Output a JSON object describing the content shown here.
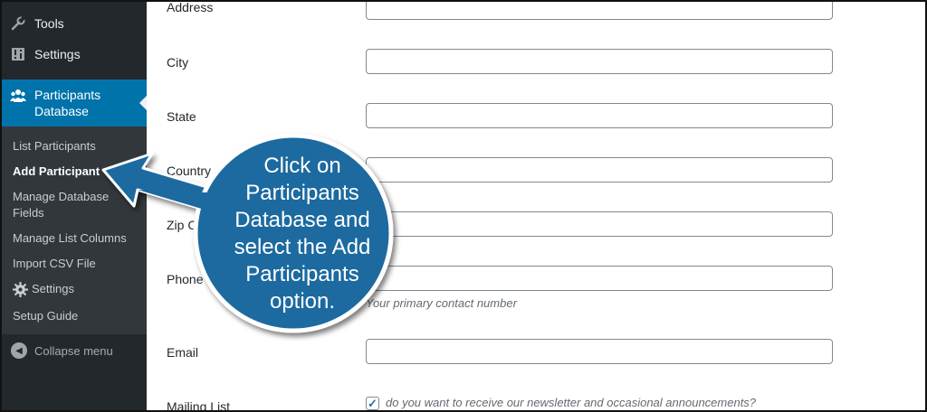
{
  "sidebar": {
    "items": [
      {
        "label": "Tools",
        "icon": "wrench-icon"
      },
      {
        "label": "Settings",
        "icon": "settings-sliders-icon"
      },
      {
        "label": "Participants Database",
        "icon": "participants-group-icon",
        "active": true
      }
    ],
    "submenu": [
      {
        "label": "List Participants"
      },
      {
        "label": "Add Participant",
        "current": true
      },
      {
        "label": "Manage Database Fields"
      },
      {
        "label": "Manage List Columns"
      },
      {
        "label": "Import CSV File"
      },
      {
        "label": "Settings",
        "icon": "gear-icon"
      },
      {
        "label": "Setup Guide"
      }
    ],
    "collapse_label": "Collapse menu",
    "active_color": "#0073aa"
  },
  "form": {
    "fields": [
      {
        "label": "Address",
        "value": ""
      },
      {
        "label": "City",
        "value": ""
      },
      {
        "label": "State",
        "value": ""
      },
      {
        "label": "Country",
        "value": ""
      },
      {
        "label": "Zip C",
        "value": ""
      },
      {
        "label": "Phone",
        "value": "",
        "help": "Your primary contact number"
      },
      {
        "label": "Email",
        "value": ""
      }
    ],
    "mailing_list": {
      "label": "Mailing List",
      "checked": true,
      "text": "do you want to receive our newsletter and occasional announcements?"
    }
  },
  "callout": {
    "lines": [
      "Click on",
      "Participants",
      "Database and",
      "select the Add",
      "Participants",
      "option."
    ],
    "color": "#1a6aa0"
  }
}
